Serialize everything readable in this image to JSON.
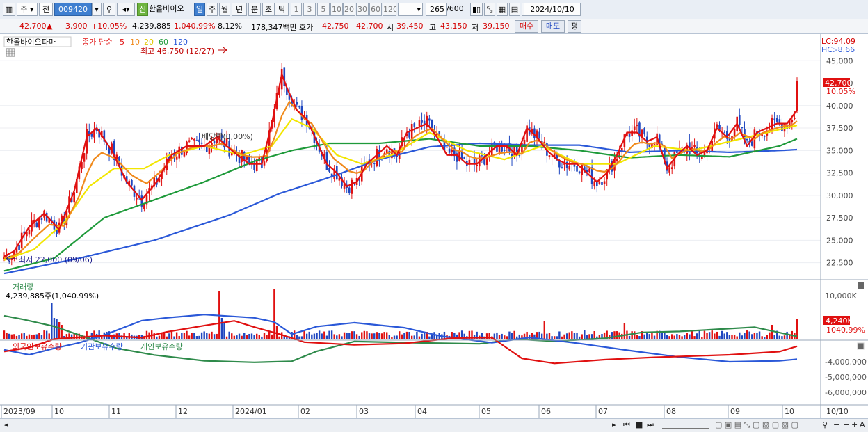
{
  "toolbar": {
    "type_sel": "주",
    "name_sel": "전",
    "code": "009420",
    "stock_name": "한올바이오",
    "badge_sin": "신",
    "periods": [
      "일",
      "주",
      "월",
      "년",
      "분",
      "초",
      "틱"
    ],
    "nums": [
      "1",
      "3",
      "5",
      "10",
      "20",
      "30",
      "60",
      "120"
    ],
    "count": "265",
    "total": "/600",
    "date": "2024/10/10"
  },
  "quote": {
    "price": "42,700",
    "arrow": "▲",
    "change": "3,900",
    "pct": "+10.05%",
    "volume": "4,239,885",
    "vol_pct": "1,040.99%",
    "turnover": "8.12%",
    "amount": "178,347백만",
    "ask_label": "호가",
    "ask": "42,750",
    "bid": "42,700",
    "open_label": "시",
    "open": "39,450",
    "high_label": "고",
    "high": "43,150",
    "low_label": "저",
    "low": "39,150",
    "buy": "매수",
    "sell": "매도",
    "eval": "평"
  },
  "price_panel": {
    "legend_name": "한올바이오파마",
    "legend_ma": "종가 단순",
    "ma_labels": [
      "5",
      "10",
      "20",
      "60",
      "120"
    ],
    "high_note": "최고 46,750 (12/27)",
    "low_note": "최저 22,000 (09/06)",
    "dividend_note": "배당락(0,00%)",
    "lc": "LC:94.09",
    "hc": "HC:-8.66",
    "last_price": "42,700",
    "last_pct": "10.05%",
    "y_ticks": [
      "45,000",
      "42,500",
      "40,000",
      "37,500",
      "35,000",
      "32,500",
      "30,000",
      "27,500",
      "25,000",
      "22,500"
    ]
  },
  "vol_panel": {
    "title": "거래량",
    "subtitle": "4,239,885주(1,040.99%)",
    "y_tick": "10,000K",
    "last": "4,240K",
    "last_pct": "1040.99%"
  },
  "hold_panel": {
    "legend": [
      "외국인보유수량",
      "기관보유수량",
      "개인보유수량"
    ],
    "y_ticks": [
      "-4,000,000",
      "-5,000,000",
      "-6,000,000"
    ]
  },
  "x_labels": [
    "2023/09",
    "10",
    "11",
    "12",
    "2024/01",
    "02",
    "03",
    "04",
    "05",
    "06",
    "07",
    "08",
    "09",
    "10"
  ],
  "x_end": "10/10",
  "colors": {
    "ma5": "#e01010",
    "ma10": "#f08a1c",
    "ma20": "#f2e600",
    "ma60": "#1e9a3a",
    "ma120": "#2a58d8",
    "up": "#e01010",
    "down": "#1f47c0",
    "foreign": "#e01010",
    "inst": "#2a58d8",
    "indiv": "#2e8a4a"
  },
  "chart_data": {
    "type": "line",
    "title": "한올바이오파마",
    "x_range": [
      "2023/09",
      "2024/10/10"
    ],
    "ylim": [
      21000,
      47500
    ],
    "series": [
      {
        "name": "5",
        "approx_path": [
          [
            0,
            23200
          ],
          [
            4,
            23800
          ],
          [
            10,
            26500
          ],
          [
            16,
            28000
          ],
          [
            22,
            26200
          ],
          [
            28,
            30500
          ],
          [
            33,
            36500
          ],
          [
            37,
            37500
          ],
          [
            43,
            35000
          ],
          [
            49,
            31500
          ],
          [
            55,
            29500
          ],
          [
            61,
            31500
          ],
          [
            67,
            34500
          ],
          [
            73,
            35500
          ],
          [
            80,
            35500
          ],
          [
            85,
            36500
          ],
          [
            91,
            35000
          ],
          [
            98,
            33500
          ],
          [
            103,
            33500
          ],
          [
            107,
            38000
          ],
          [
            111,
            43500
          ],
          [
            113,
            42000
          ],
          [
            117,
            39500
          ],
          [
            121,
            38500
          ],
          [
            125,
            36000
          ],
          [
            129,
            33500
          ],
          [
            133,
            32500
          ],
          [
            137,
            31000
          ],
          [
            141,
            31500
          ],
          [
            145,
            33500
          ],
          [
            149,
            34500
          ],
          [
            153,
            35500
          ],
          [
            157,
            34500
          ],
          [
            161,
            37000
          ],
          [
            165,
            37500
          ],
          [
            169,
            38000
          ],
          [
            173,
            36500
          ],
          [
            177,
            34500
          ],
          [
            181,
            34500
          ],
          [
            185,
            33500
          ],
          [
            189,
            33500
          ],
          [
            193,
            34500
          ],
          [
            197,
            35500
          ],
          [
            201,
            35500
          ],
          [
            205,
            34500
          ],
          [
            209,
            37500
          ],
          [
            213,
            36500
          ],
          [
            217,
            35000
          ],
          [
            221,
            34000
          ],
          [
            225,
            33500
          ],
          [
            229,
            33500
          ],
          [
            233,
            32500
          ],
          [
            237,
            31500
          ],
          [
            241,
            32500
          ],
          [
            245,
            34500
          ],
          [
            249,
            37000
          ],
          [
            253,
            37000
          ],
          [
            257,
            36000
          ],
          [
            261,
            36500
          ],
          [
            265,
            33000
          ],
          [
            269,
            34500
          ],
          [
            273,
            35500
          ],
          [
            277,
            34500
          ],
          [
            281,
            35000
          ],
          [
            285,
            37500
          ],
          [
            289,
            36500
          ],
          [
            293,
            38000
          ],
          [
            297,
            35500
          ],
          [
            301,
            37000
          ],
          [
            305,
            37500
          ],
          [
            309,
            38000
          ],
          [
            313,
            38000
          ],
          [
            317,
            39500
          ]
        ]
      },
      {
        "name": "20",
        "approx_path": [
          [
            0,
            22800
          ],
          [
            12,
            24000
          ],
          [
            24,
            27000
          ],
          [
            34,
            31000
          ],
          [
            44,
            33000
          ],
          [
            56,
            33000
          ],
          [
            66,
            34500
          ],
          [
            80,
            35500
          ],
          [
            95,
            34500
          ],
          [
            107,
            35500
          ],
          [
            115,
            38500
          ],
          [
            123,
            37500
          ],
          [
            133,
            34500
          ],
          [
            143,
            33500
          ],
          [
            155,
            34500
          ],
          [
            170,
            37000
          ],
          [
            185,
            35000
          ],
          [
            200,
            34000
          ],
          [
            215,
            35500
          ],
          [
            230,
            33500
          ],
          [
            245,
            33500
          ],
          [
            260,
            35500
          ],
          [
            275,
            35000
          ],
          [
            290,
            36000
          ],
          [
            305,
            37000
          ],
          [
            317,
            37800
          ]
        ]
      },
      {
        "name": "60",
        "approx_path": [
          [
            0,
            21600
          ],
          [
            20,
            23000
          ],
          [
            40,
            27500
          ],
          [
            60,
            29500
          ],
          [
            80,
            31500
          ],
          [
            100,
            33800
          ],
          [
            115,
            35000
          ],
          [
            130,
            35800
          ],
          [
            150,
            35800
          ],
          [
            170,
            36300
          ],
          [
            190,
            35500
          ],
          [
            210,
            35500
          ],
          [
            230,
            35000
          ],
          [
            250,
            34200
          ],
          [
            270,
            34500
          ],
          [
            290,
            34300
          ],
          [
            310,
            35500
          ],
          [
            317,
            36300
          ]
        ]
      },
      {
        "name": "120",
        "approx_path": [
          [
            0,
            21300
          ],
          [
            30,
            23000
          ],
          [
            60,
            25000
          ],
          [
            90,
            27800
          ],
          [
            110,
            30200
          ],
          [
            130,
            32000
          ],
          [
            150,
            34000
          ],
          [
            170,
            35400
          ],
          [
            190,
            35800
          ],
          [
            210,
            35600
          ],
          [
            230,
            35600
          ],
          [
            250,
            34800
          ],
          [
            270,
            35000
          ],
          [
            290,
            34800
          ],
          [
            310,
            35000
          ],
          [
            317,
            35100
          ]
        ]
      }
    ]
  }
}
